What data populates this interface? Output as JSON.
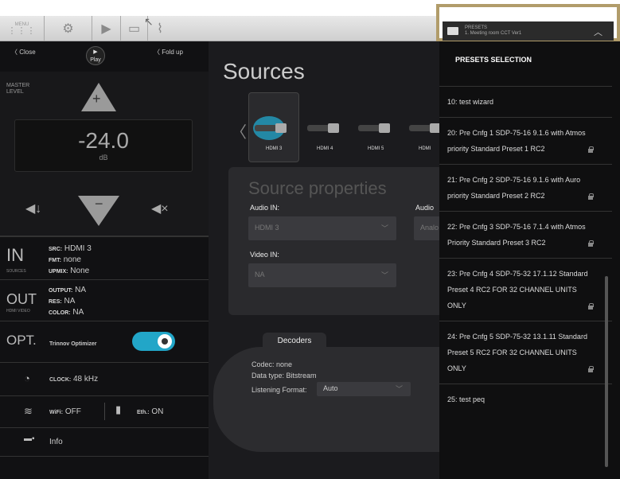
{
  "toolbar": {
    "menu_label": "MENU",
    "presets_header": {
      "label": "PRESETS",
      "current": "1. Meeting room CCT Ver1"
    }
  },
  "left_panel": {
    "close_label": "Close",
    "fold_label": "Fold up",
    "logo_text": "Play",
    "master_label_1": "MASTER",
    "master_label_2": "LEVEL",
    "level_value": "-24.0",
    "level_unit": "dB",
    "sources": {
      "big": "IN",
      "sub": "SOURCES",
      "src_key": "SRC:",
      "src_val": "HDMI 3",
      "fmt_key": "FMT:",
      "fmt_val": "none",
      "upmix_key": "UPMIX:",
      "upmix_val": "None"
    },
    "outputs": {
      "big": "OUT",
      "sub": "HDMI VIDEO",
      "output_key": "OUTPUT:",
      "output_val": "NA",
      "res_key": "RES:",
      "res_val": "NA",
      "color_key": "COLOR:",
      "color_val": "NA"
    },
    "opt": {
      "big": "OPT.",
      "label": "Trinnov Optimizer",
      "enabled": true
    },
    "clock": {
      "key": "CLOCK:",
      "val": "48 kHz"
    },
    "wifi": {
      "key": "WiFi:",
      "val": "OFF"
    },
    "eth": {
      "key": "Eth.:",
      "val": "ON"
    },
    "info_label": "Info"
  },
  "main": {
    "title": "Sources",
    "sources": [
      "HDMI 3",
      "HDMI 4",
      "HDMI 5",
      "HDMI"
    ],
    "selected_source": "HDMI 3",
    "props_title": "Source properties",
    "audio_in_label": "Audio IN:",
    "audio_in_value": "HDMI 3",
    "audio_label_2": "Audio",
    "audio_value_2": "Analo",
    "video_in_label": "Video IN:",
    "video_in_value": "NA",
    "decoders_tab": "Decoders",
    "codec": "Codec: none",
    "data_type": "Data type: Bitstream",
    "listening_label": "Listening Format:",
    "listening_value": "Auto"
  },
  "presets": {
    "title": "PRESETS SELECTION",
    "items": [
      {
        "text": "10: test wizard",
        "locked": false
      },
      {
        "text": "20: Pre Cnfg 1 SDP-75-16 9.1.6 with Atmos priority Standard Preset 1 RC2",
        "locked": true
      },
      {
        "text": "21: Pre Cnfg 2 SDP-75-16 9.1.6 with Auro priority Standard Preset 2 RC2",
        "locked": true
      },
      {
        "text": "22: Pre Cnfg 3 SDP-75-16 7.1.4 with Atmos Priority Standard Preset 3 RC2",
        "locked": true
      },
      {
        "text": "23: Pre Cnfg 4 SDP-75-32 17.1.12 Standard Preset 4 RC2 FOR 32 CHANNEL UNITS ONLY",
        "locked": true
      },
      {
        "text": "24: Pre Cnfg 5 SDP-75-32 13.1.11 Standard Preset 5 RC2 FOR 32 CHANNEL UNITS ONLY",
        "locked": true
      },
      {
        "text": "25: test peq",
        "locked": false
      }
    ]
  },
  "colors": {
    "accent": "#22a6c8",
    "highlight_border": "#b19c6a"
  }
}
